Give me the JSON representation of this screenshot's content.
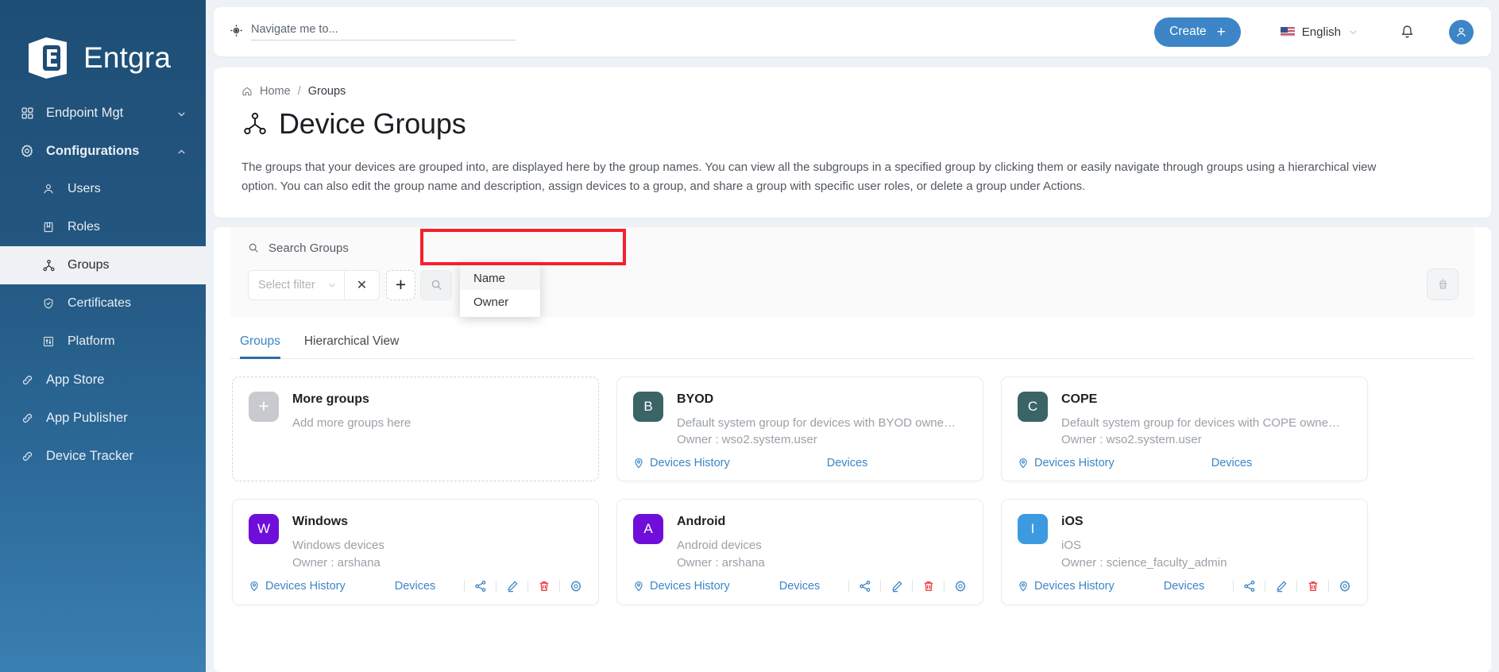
{
  "brand": {
    "name": "Entgra",
    "logo_icon": "entgra-logo-icon"
  },
  "sidebar": {
    "items": [
      {
        "label": "Endpoint Mgt",
        "icon": "grid-icon",
        "level": "top",
        "chevron": "chevron-down-icon",
        "active": false,
        "bold": false
      },
      {
        "label": "Configurations",
        "icon": "gear-icon",
        "level": "top",
        "chevron": "chevron-up-icon",
        "active": false,
        "bold": true
      },
      {
        "label": "Users",
        "icon": "user-icon",
        "level": "sub",
        "active": false,
        "bold": false
      },
      {
        "label": "Roles",
        "icon": "book-icon",
        "level": "sub",
        "active": false,
        "bold": false
      },
      {
        "label": "Groups",
        "icon": "groups-icon",
        "level": "sub",
        "active": true,
        "bold": false
      },
      {
        "label": "Certificates",
        "icon": "shield-check-icon",
        "level": "sub",
        "active": false,
        "bold": false
      },
      {
        "label": "Platform",
        "icon": "sliders-icon",
        "level": "sub",
        "active": false,
        "bold": false
      },
      {
        "label": "App Store",
        "icon": "link-icon",
        "level": "top",
        "active": false,
        "bold": false
      },
      {
        "label": "App Publisher",
        "icon": "link-icon",
        "level": "top",
        "active": false,
        "bold": false
      },
      {
        "label": "Device Tracker",
        "icon": "link-icon",
        "level": "top",
        "active": false,
        "bold": false
      }
    ]
  },
  "topbar": {
    "navigate_placeholder": "Navigate me to...",
    "navigate_value": "",
    "navigate_icon": "navigate-target-icon",
    "create_label": "Create",
    "create_plus": "+",
    "create_color": "#3d85c6",
    "language": "English",
    "language_flag": "us-flag-icon",
    "bell_icon": "notification-bell-icon",
    "avatar_icon": "user-avatar-icon"
  },
  "breadcrumb": {
    "home": "Home",
    "sep": "/",
    "current": "Groups",
    "home_icon": "home-icon"
  },
  "page": {
    "title": "Device Groups",
    "title_icon": "device-groups-icon",
    "description": "The groups that your devices are grouped into, are displayed here by the group names. You can view all the subgroups in a specified group by clicking them or easily navigate through groups using a hierarchical view option. You can also edit the group name and description, assign devices to a group, and share a group with specific user roles, or delete a group under Actions."
  },
  "filters": {
    "search_label": "Search Groups",
    "search_icon": "search-icon",
    "select_filter_placeholder": "Select filter",
    "select_filter_value": "",
    "chevron_icon": "chevron-down-icon",
    "clear_label": "✕",
    "add_label": "+",
    "search_button_icon": "search-icon",
    "clear_all_icon": "broom-icon",
    "dropdown_options": [
      "Name",
      "Owner"
    ],
    "highlight_color": "#f4212d"
  },
  "tabs": [
    {
      "label": "Groups",
      "active": true
    },
    {
      "label": "Hierarchical View",
      "active": false
    }
  ],
  "cards": [
    {
      "kind": "add",
      "badge": "+",
      "badge_color": "#c8cacd",
      "title": "More groups",
      "subtitle": "Add more groups here",
      "owner": "",
      "history_label": "",
      "devices_label": "",
      "has_icons": false
    },
    {
      "kind": "group",
      "badge": "B",
      "badge_color": "#3a6465",
      "title": "BYOD",
      "subtitle": "Default system group for devices with BYOD owne…",
      "owner": "Owner : wso2.system.user",
      "history_label": "Devices History",
      "devices_label": "Devices",
      "has_icons": false
    },
    {
      "kind": "group",
      "badge": "C",
      "badge_color": "#3a6465",
      "title": "COPE",
      "subtitle": "Default system group for devices with COPE owne…",
      "owner": "Owner : wso2.system.user",
      "history_label": "Devices History",
      "devices_label": "Devices",
      "has_icons": false
    },
    {
      "kind": "group",
      "badge": "W",
      "badge_color": "#6f0ed9",
      "title": "Windows",
      "subtitle": "Windows devices",
      "owner": "Owner : arshana",
      "history_label": "Devices History",
      "devices_label": "Devices",
      "has_icons": true
    },
    {
      "kind": "group",
      "badge": "A",
      "badge_color": "#6f0ed9",
      "title": "Android",
      "subtitle": "Android devices",
      "owner": "Owner : arshana",
      "history_label": "Devices History",
      "devices_label": "Devices",
      "has_icons": true
    },
    {
      "kind": "group",
      "badge": "I",
      "badge_color": "#3d9ae0",
      "title": "iOS",
      "subtitle": "iOS",
      "owner": "Owner : science_faculty_admin",
      "history_label": "Devices History",
      "devices_label": "Devices",
      "has_icons": true
    }
  ],
  "card_action_icons": [
    {
      "name": "share-icon",
      "color": "#3d85c6"
    },
    {
      "name": "edit-pencil-icon",
      "color": "#3d85c6"
    },
    {
      "name": "delete-trash-icon",
      "color": "#f0383f"
    },
    {
      "name": "settings-gear-icon",
      "color": "#3d85c6"
    }
  ]
}
